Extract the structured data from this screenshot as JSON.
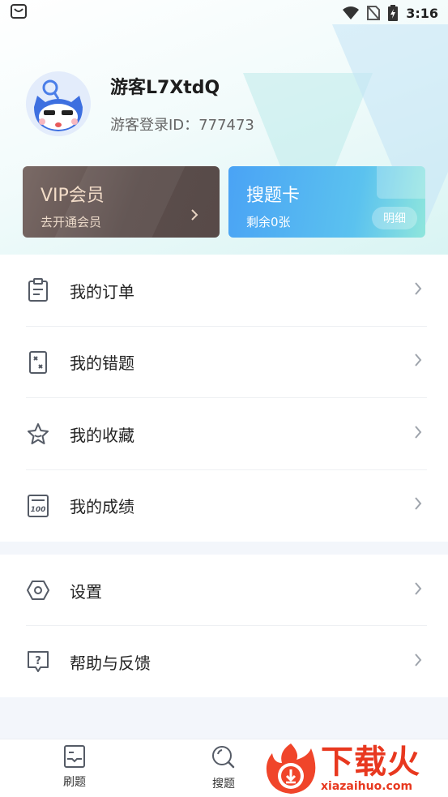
{
  "status_bar": {
    "time": "3:16"
  },
  "profile": {
    "username": "游客L7XtdQ",
    "user_id": "游客登录ID：777473"
  },
  "cards": {
    "vip": {
      "title": "VIP会员",
      "subtitle": "去开通会员"
    },
    "search_card": {
      "title": "搜题卡",
      "subtitle": "剩余0张",
      "detail_label": "明细"
    }
  },
  "menu": {
    "items": [
      {
        "label": "我的订单",
        "icon": "clipboard-icon"
      },
      {
        "label": "我的错题",
        "icon": "wrong-questions-icon"
      },
      {
        "label": "我的收藏",
        "icon": "star-icon"
      },
      {
        "label": "我的成绩",
        "icon": "score-100-icon"
      }
    ],
    "settings": [
      {
        "label": "设置",
        "icon": "hexagon-gear-icon"
      },
      {
        "label": "帮助与反馈",
        "icon": "help-chat-icon"
      }
    ]
  },
  "tabbar": {
    "tabs": [
      {
        "label": "刷题",
        "icon": "practice-icon"
      },
      {
        "label": "搜题",
        "icon": "search-icon"
      }
    ]
  },
  "watermark": {
    "cn": "下载火",
    "en": "xiazaihuo.com"
  },
  "colors": {
    "accent_blue": "#4aa3f5",
    "vip_brown": "#5b4d4b",
    "watermark_red": "#e8381f"
  }
}
